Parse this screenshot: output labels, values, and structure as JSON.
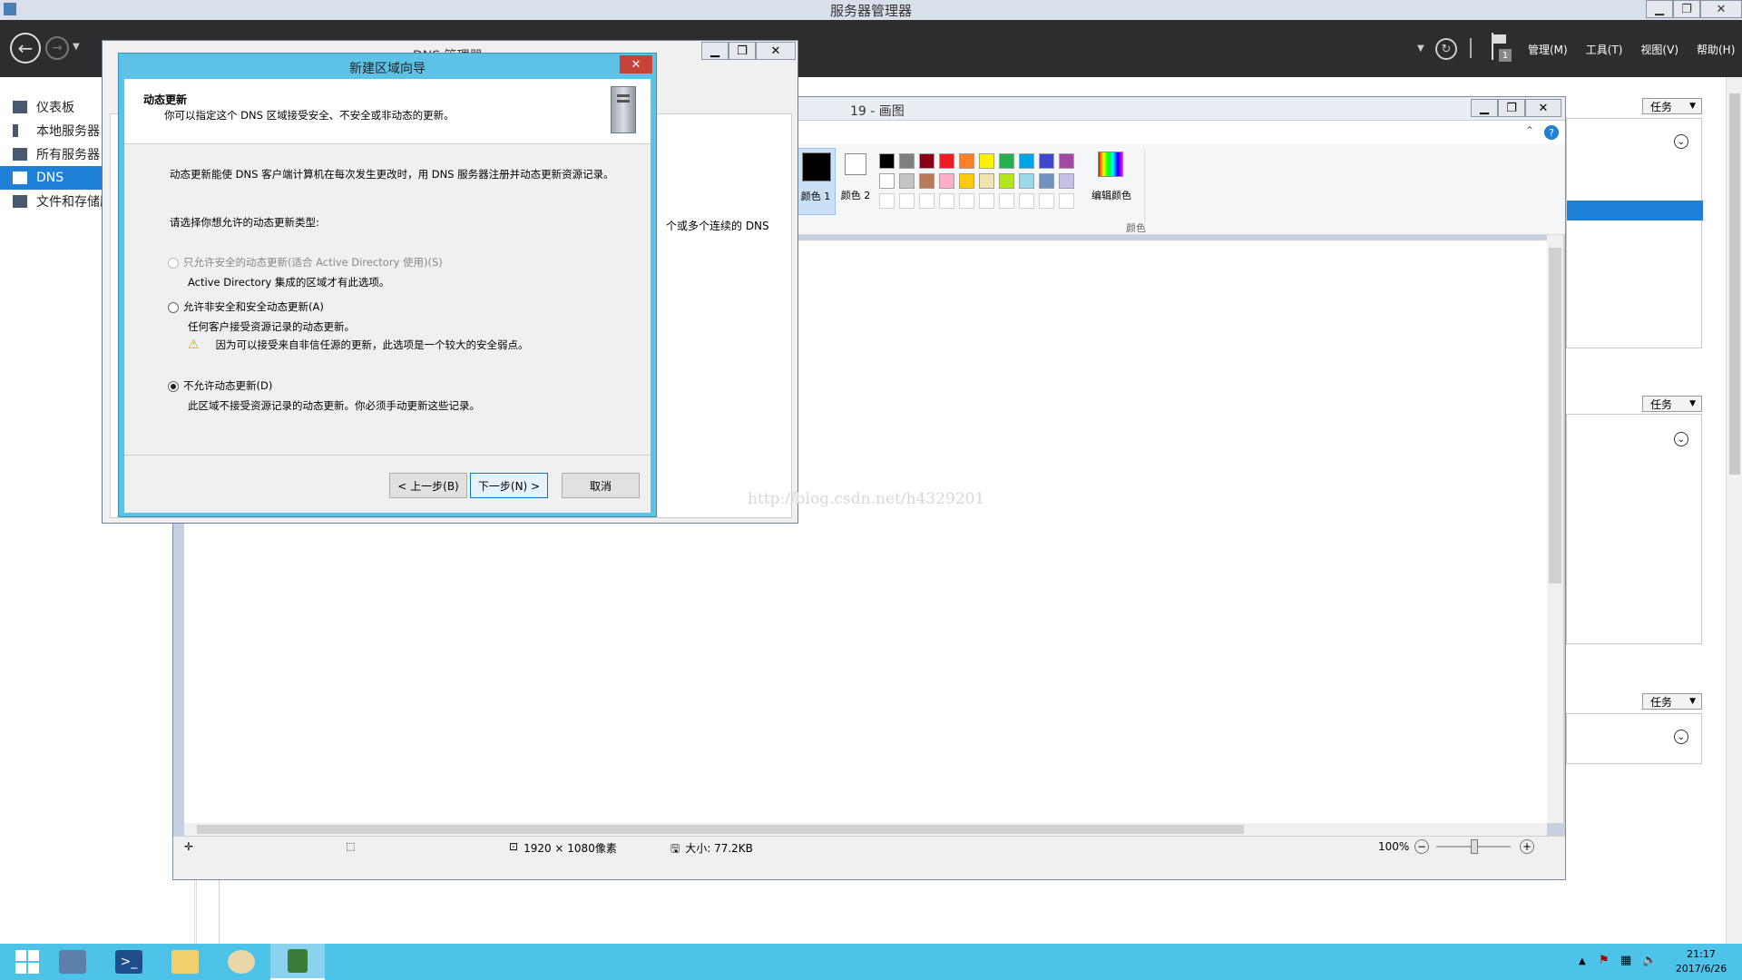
{
  "server_manager": {
    "title": "服务器管理器",
    "menu": [
      "管理(M)",
      "工具(T)",
      "视图(V)",
      "帮助(H)"
    ],
    "flag_count": "1",
    "sidebar": [
      {
        "label": "仪表板"
      },
      {
        "label": "本地服务器"
      },
      {
        "label": "所有服务器"
      },
      {
        "label": "DNS"
      },
      {
        "label": "文件和存储服务"
      }
    ],
    "task_label": "任务"
  },
  "dns_manager": {
    "title": "DNS 管理器",
    "bg_text": "个或多个连续的 DNS"
  },
  "paint": {
    "title": "19 - 画图",
    "color1_label": "颜色 1",
    "color2_label": "颜色 2",
    "edit_colors_label": "编辑颜色",
    "colors_group_label": "颜色",
    "palette_row1": [
      "#000000",
      "#7f7f7f",
      "#880015",
      "#ed1c24",
      "#ff7f27",
      "#fff200",
      "#22b14c",
      "#00a2e8",
      "#3f48cc",
      "#a349a4"
    ],
    "palette_row2": [
      "#ffffff",
      "#c3c3c3",
      "#b97a57",
      "#ffaec9",
      "#ffc90e",
      "#efe4b0",
      "#b5e61d",
      "#99d9ea",
      "#7092be",
      "#c8bfe7"
    ],
    "status": {
      "dimensions": "1920 × 1080像素",
      "size": "大小: 77.2KB",
      "zoom": "100%"
    }
  },
  "wizard": {
    "title": "新建区域向导",
    "header_title": "动态更新",
    "header_desc": "你可以指定这个 DNS 区域接受安全、不安全或非动态的更新。",
    "intro": "动态更新能使 DNS 客户端计算机在每次发生更改时，用 DNS 服务器注册并动态更新资源记录。",
    "prompt": "请选择你想允许的动态更新类型:",
    "options": [
      {
        "label": "只允许安全的动态更新(适合 Active Directory 使用)(S)",
        "desc": "Active Directory 集成的区域才有此选项。",
        "state": "disabled"
      },
      {
        "label": "允许非安全和安全动态更新(A)",
        "desc": "任何客户接受资源记录的动态更新。",
        "warning": "因为可以接受来自非信任源的更新，此选项是一个较大的安全弱点。",
        "state": "unchecked"
      },
      {
        "label": "不允许动态更新(D)",
        "desc": "此区域不接受资源记录的动态更新。你必须手动更新这些记录。",
        "state": "checked"
      }
    ],
    "back_button": "< 上一步(B)",
    "next_button": "下一步(N) >",
    "cancel_button": "取消"
  },
  "watermark": "http://blog.csdn.net/h4329201",
  "taskbar": {
    "time": "21:17",
    "date": "2017/6/26"
  }
}
